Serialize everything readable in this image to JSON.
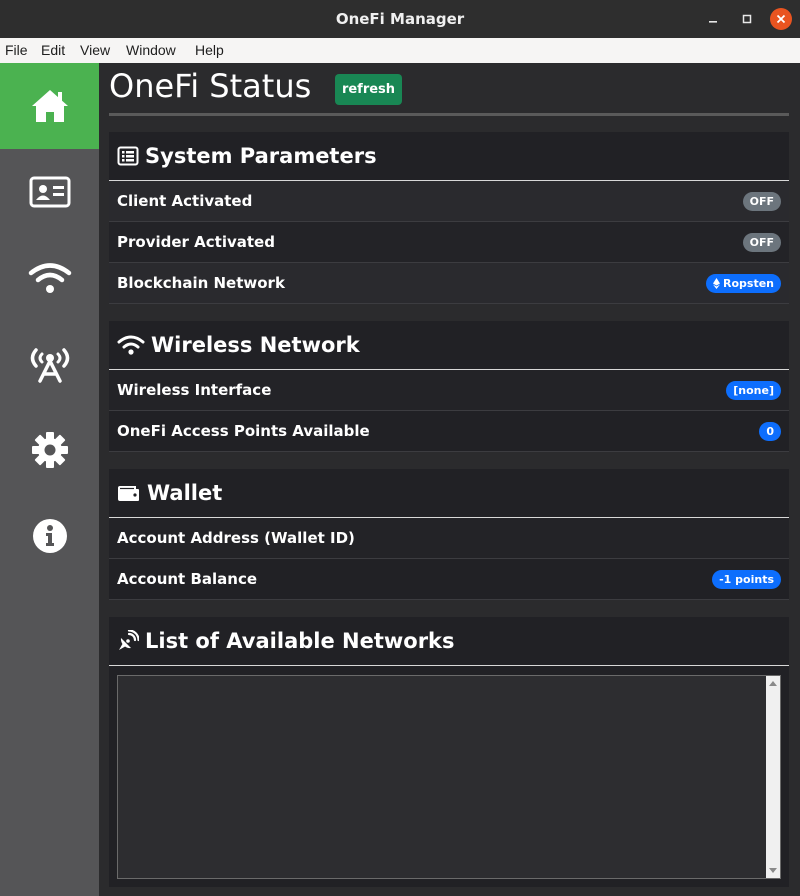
{
  "window": {
    "title": "OneFi Manager"
  },
  "menu": {
    "items": [
      "File",
      "Edit",
      "View",
      "Window",
      "Help"
    ]
  },
  "sidebar": {
    "items": [
      {
        "icon": "home-icon",
        "active": true
      },
      {
        "icon": "id-card-icon",
        "active": false
      },
      {
        "icon": "wifi-icon",
        "active": false
      },
      {
        "icon": "broadcast-tower-icon",
        "active": false
      },
      {
        "icon": "gear-icon",
        "active": false
      },
      {
        "icon": "info-icon",
        "active": false
      }
    ]
  },
  "header": {
    "title": "OneFi Status",
    "refresh_label": "refresh",
    "refresh_color": "#198754"
  },
  "system": {
    "title": "System Parameters",
    "icon": "list-icon",
    "rows": [
      {
        "label": "Client Activated",
        "value": "OFF"
      },
      {
        "label": "Provider Activated",
        "value": "OFF"
      },
      {
        "label": "Blockchain Network",
        "value": "Ropsten",
        "value_icon": "ethereum-icon"
      }
    ]
  },
  "wireless": {
    "title": "Wireless Network",
    "icon": "wifi-icon",
    "rows": [
      {
        "label": "Wireless Interface",
        "value": "[none]"
      },
      {
        "label": "OneFi Access Points Available",
        "value": "0"
      }
    ]
  },
  "wallet": {
    "title": "Wallet",
    "icon": "wallet-icon",
    "rows": [
      {
        "label": "Account Address (Wallet ID)"
      },
      {
        "label": "Account Balance",
        "value": "-1 points"
      }
    ]
  },
  "networks": {
    "title": "List of Available Networks",
    "icon": "satellite-dish-icon"
  },
  "colors": {
    "accent_green": "#4bb250",
    "badge_blue": "#0d6efd",
    "badge_gray": "#6c757d",
    "close_orange": "#e95420"
  }
}
